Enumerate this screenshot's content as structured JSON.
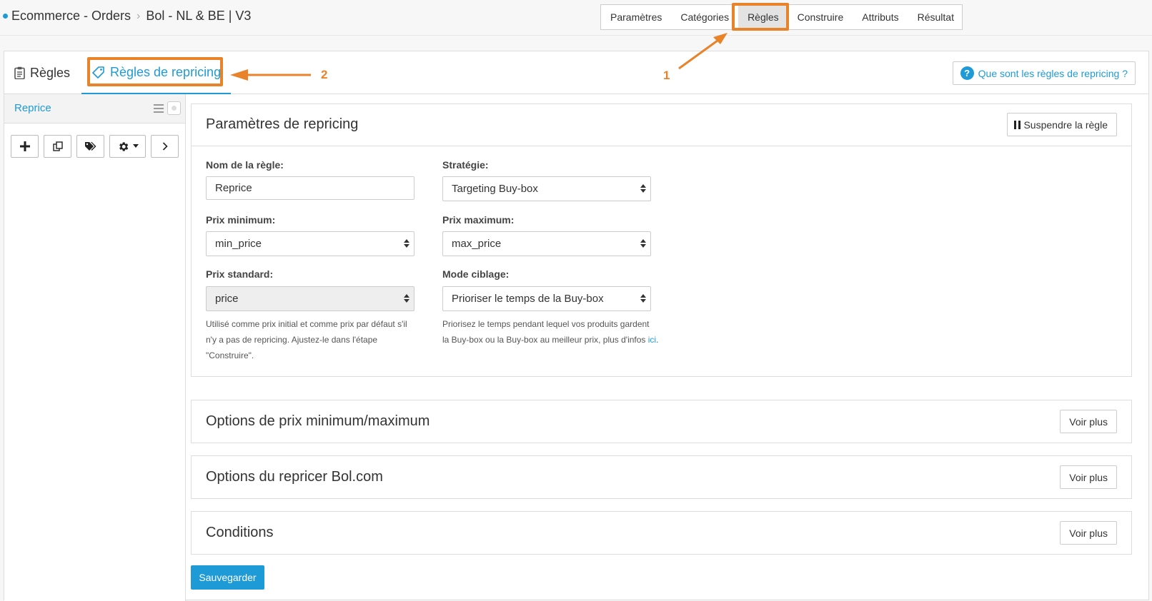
{
  "breadcrumb": [
    "Ecommerce - Orders",
    "Bol - NL & BE | V3"
  ],
  "steps": [
    "Paramètres",
    "Catégories",
    "Règles",
    "Construire",
    "Attributs",
    "Résultat"
  ],
  "active_step": "Règles",
  "tabs": {
    "rules": "Règles",
    "repricing": "Règles de repricing"
  },
  "help_link": "Que sont les règles de repricing ?",
  "sidebar": {
    "item_label": "Reprice"
  },
  "settings": {
    "title": "Paramètres de repricing",
    "suspend_label": "Suspendre la règle",
    "rule_name": {
      "label": "Nom de la règle:",
      "value": "Reprice"
    },
    "strategy": {
      "label": "Stratégie:",
      "value": "Targeting Buy-box"
    },
    "min_price": {
      "label": "Prix minimum:",
      "value": "min_price"
    },
    "max_price": {
      "label": "Prix maximum:",
      "value": "max_price"
    },
    "std_price": {
      "label": "Prix standard:",
      "value": "price",
      "help": [
        "Utilisé comme prix initial et comme prix par défaut s'il",
        "n'y a pas de repricing. Ajustez-le dans l'étape",
        "\"Construire\"."
      ]
    },
    "target_mode": {
      "label": "Mode ciblage:",
      "value": "Prioriser le temps de la Buy-box",
      "help_line1": "Priorisez le temps pendant lequel vos produits gardent",
      "help_line2": "la Buy-box ou la Buy-box au meilleur prix, plus d'infos ",
      "help_link": "ici",
      "help_end": "."
    }
  },
  "sections": [
    {
      "title": "Options de prix minimum/maximum",
      "button": "Voir plus"
    },
    {
      "title": "Options du repricer Bol.com",
      "button": "Voir plus"
    },
    {
      "title": "Conditions",
      "button": "Voir plus"
    }
  ],
  "save_label": "Sauvegarder",
  "annotations": {
    "one": "1",
    "two": "2",
    "color": "#e8832a"
  },
  "colors": {
    "accent": "#1e9bd7",
    "annotation": "#e8832a"
  }
}
